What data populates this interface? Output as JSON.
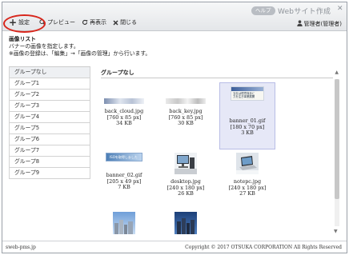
{
  "header": {
    "help_label": "ヘルプ",
    "app_title": "Webサイト作成",
    "close_label": "✕"
  },
  "toolbar": {
    "settings_label": "設定",
    "preview_label": "プレビュー",
    "reload_label": "再表示",
    "close_label": "閉じる"
  },
  "user": {
    "label": "管理者(管理者)"
  },
  "description": {
    "title": "画像リスト",
    "line1": "バナーの画像を指定します。",
    "line2": "※画像の登録は、「編集」→「画像の管理」から行います。"
  },
  "sidebar": {
    "items": [
      {
        "label": "グループなし"
      },
      {
        "label": "グループ1"
      },
      {
        "label": "グループ2"
      },
      {
        "label": "グループ3"
      },
      {
        "label": "グループ4"
      },
      {
        "label": "グループ5"
      },
      {
        "label": "グループ6"
      },
      {
        "label": "グループ7"
      },
      {
        "label": "グループ8"
      },
      {
        "label": "グループ9"
      }
    ]
  },
  "main": {
    "group_heading": "グループなし",
    "images": [
      {
        "name": "back_cloud.jpg",
        "dims": "[760 x 85 px]",
        "size": "34 KB",
        "selected": false
      },
      {
        "name": "back_key.jpg",
        "dims": "[760 x 85 px]",
        "size": "30 KB",
        "selected": false
      },
      {
        "name": "banner_01.gif",
        "dims": "[180 x 70 px]",
        "size": "3 KB",
        "selected": true
      },
      {
        "name": "banner_02.gif",
        "dims": "[205 x 49 px]",
        "size": "7 KB",
        "selected": false
      },
      {
        "name": "desktop.jpg",
        "dims": "[240 x 180 px]",
        "size": "26 KB",
        "selected": false
      },
      {
        "name": "notepc.jpg",
        "dims": "[240 x 180 px]",
        "size": "27 KB",
        "selected": false
      },
      {
        "name": "",
        "dims": "",
        "size": "",
        "selected": false
      },
      {
        "name": "",
        "dims": "",
        "size": "",
        "selected": false
      }
    ],
    "banner_01_text": "当社は環境保全に\n力を注ぎ事業展開",
    "banner_02_text": "ISOを取得しました"
  },
  "footer": {
    "left": "sweb-pms.jp",
    "right": "Copyright © 2017 OTSUKA CORPORATION All Rights Reserved"
  },
  "colors": {
    "accent_red": "#d8261c",
    "selected_bg": "#e6e8f7"
  }
}
